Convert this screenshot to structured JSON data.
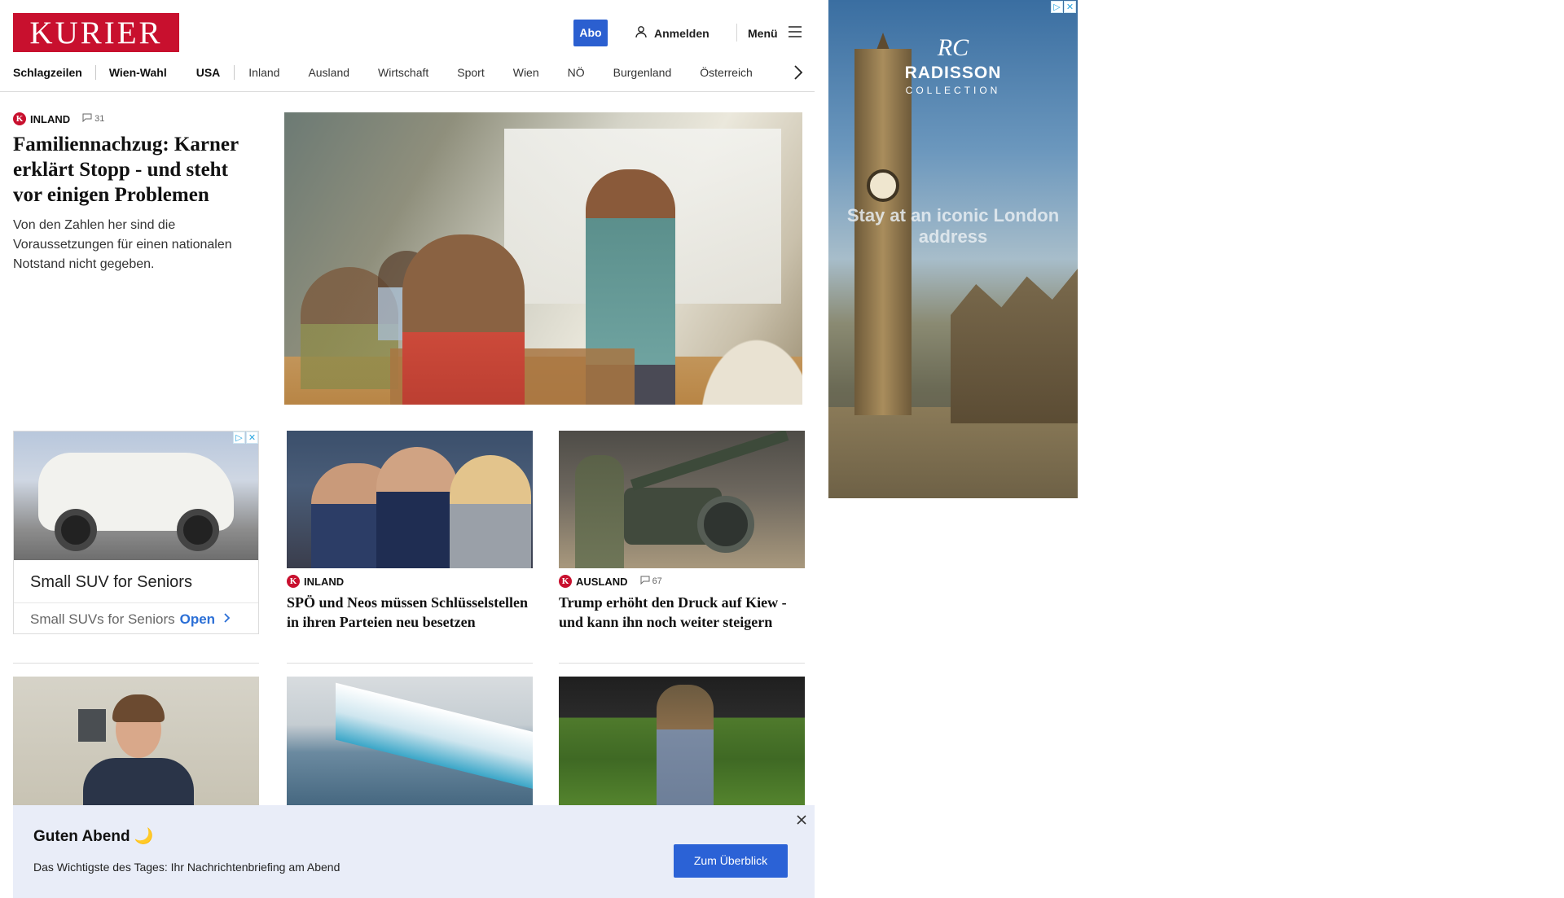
{
  "header": {
    "logo": "KURIER",
    "abo_label": "Abo",
    "login_label": "Anmelden",
    "menu_label": "Menü"
  },
  "nav": {
    "items": [
      {
        "label": "Schlagzeilen",
        "bold": true
      },
      {
        "label": "Wien-Wahl",
        "bold": true
      },
      {
        "label": "USA",
        "bold": true
      },
      {
        "label": "Inland",
        "bold": false
      },
      {
        "label": "Ausland",
        "bold": false
      },
      {
        "label": "Wirtschaft",
        "bold": false
      },
      {
        "label": "Sport",
        "bold": false
      },
      {
        "label": "Wien",
        "bold": false
      },
      {
        "label": "NÖ",
        "bold": false
      },
      {
        "label": "Burgenland",
        "bold": false
      },
      {
        "label": "Österreich",
        "bold": false
      }
    ]
  },
  "hero": {
    "kicker": "Inland",
    "comments": "31",
    "title": "Familiennachzug: Karner erklärt Stopp - und steht vor einigen Problemen",
    "teaser": "Von den Zahlen her sind die Voraussetzungen für einen nationalen Notstand nicht gegeben."
  },
  "ad_card": {
    "title": "Small SUV for Seniors",
    "subtitle": "Small SUVs for Seniors",
    "open_label": "Open"
  },
  "articles": [
    {
      "kicker": "Inland",
      "comments": "",
      "title": "SPÖ und Neos müssen Schlüsselstellen in ihren Parteien neu besetzen"
    },
    {
      "kicker": "Ausland",
      "comments": "67",
      "title": "Trump erhöht den Druck auf Kiew - und kann ihn noch weiter steigern"
    }
  ],
  "right_ad": {
    "brand_mark": "RC",
    "brand_name": "RADISSON",
    "brand_sub": "COLLECTION",
    "tagline": "Stay at an iconic London address"
  },
  "banner": {
    "greeting": "Guten Abend 🌙",
    "text": "Das Wichtigste des Tages: Ihr Nachrichtenbriefing am Abend",
    "cta_label": "Zum Überblick"
  },
  "icons": {
    "user": "user-icon",
    "menu": "hamburger-icon",
    "next": "chevron-right-icon",
    "comment": "comment-icon",
    "close": "close-icon",
    "adchoices": "adchoices-icon"
  },
  "colors": {
    "brand_red": "#c8102e",
    "accent_blue": "#2b5fd0",
    "banner_bg": "#e9edf8"
  }
}
